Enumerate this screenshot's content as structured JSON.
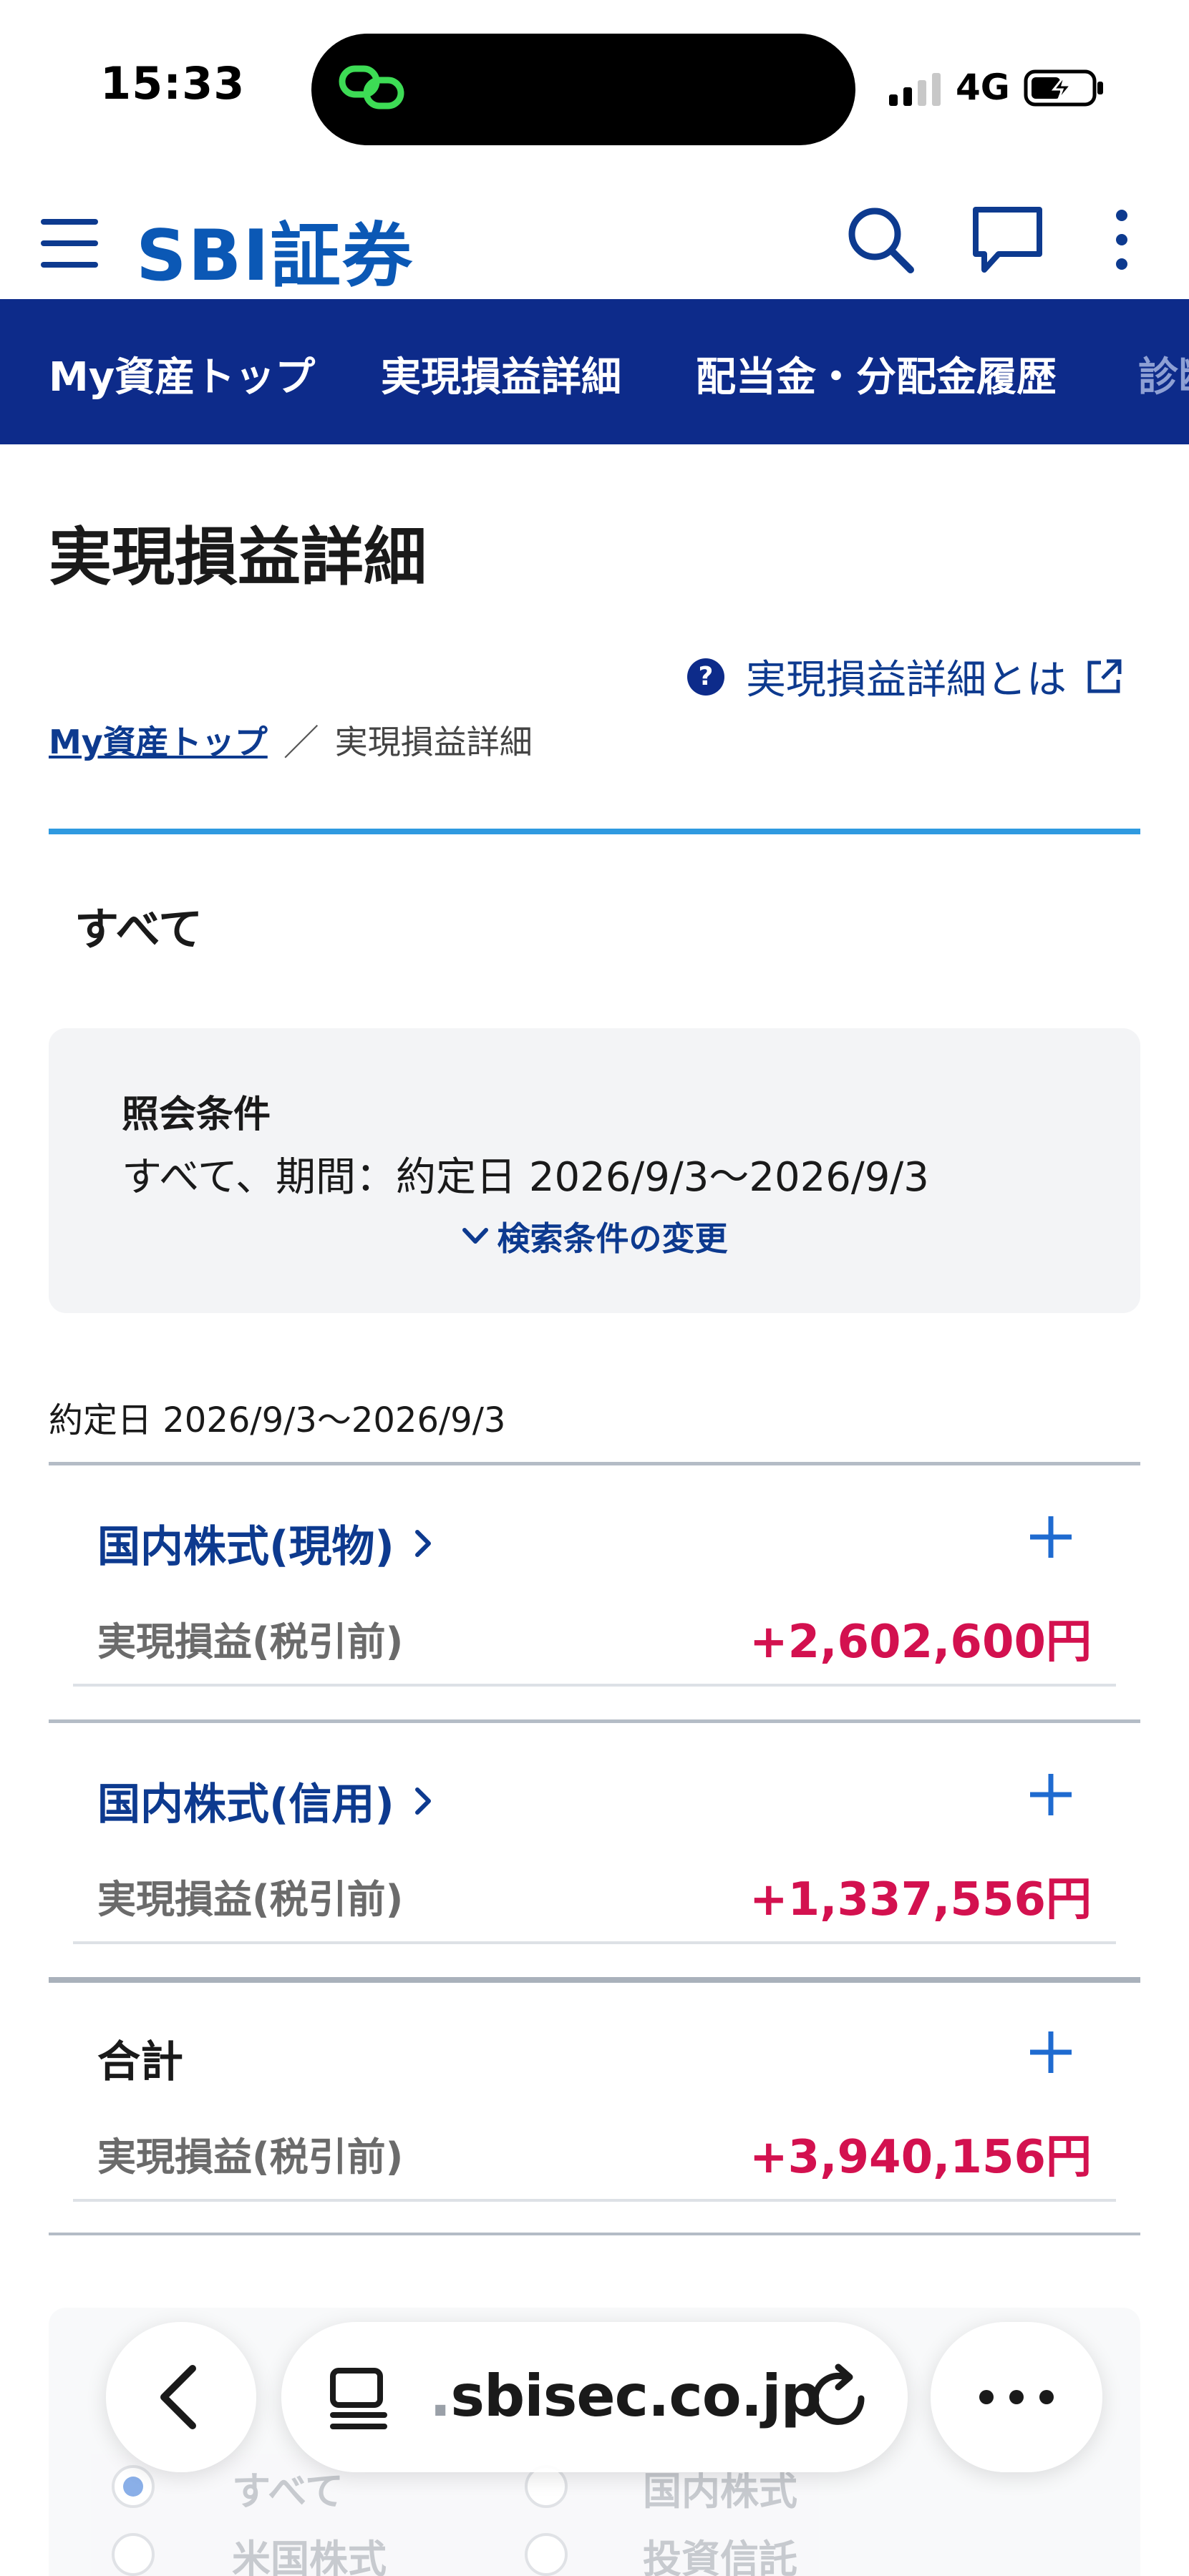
{
  "status_bar": {
    "time": "15:33",
    "network": "4G"
  },
  "header": {
    "logo": "SBI証券"
  },
  "nav": {
    "items": [
      {
        "label": "My資産トップ"
      },
      {
        "label": "実現損益詳細"
      },
      {
        "label": "配当金・分配金履歴"
      },
      {
        "label": "診断"
      }
    ]
  },
  "page": {
    "title": "実現損益詳細",
    "help_link": "実現損益詳細とは",
    "breadcrumb": {
      "home": "My資産トップ",
      "separator": "／",
      "current": "実現損益詳細"
    },
    "filter_tab": "すべて"
  },
  "conditions": {
    "title": "照会条件",
    "text": "すべて、期間：約定日 2026/9/3〜2026/9/3",
    "change_link": "検索条件の変更"
  },
  "period_label": "約定日 2026/9/3〜2026/9/3",
  "sections": [
    {
      "name": "国内株式(現物)",
      "label": "実現損益(税引前)",
      "value": "+2,602,600円"
    },
    {
      "name": "国内株式(信用)",
      "label": "実現損益(税引前)",
      "value": "+1,337,556円"
    },
    {
      "name": "合計",
      "label": "実現損益(税引前)",
      "value": "+3,940,156円"
    }
  ],
  "under_options": [
    "すべて",
    "国内株式",
    "米国株式",
    "投資信託"
  ],
  "browser": {
    "url_prefix": ".",
    "url": "sbisec.co.jp"
  },
  "colors": {
    "brand_blue": "#0b58b5",
    "nav_bg": "#0d2b8a",
    "link": "#0d3a8f",
    "profit": "#d3114f",
    "tab_accent": "#2f9ae0"
  }
}
